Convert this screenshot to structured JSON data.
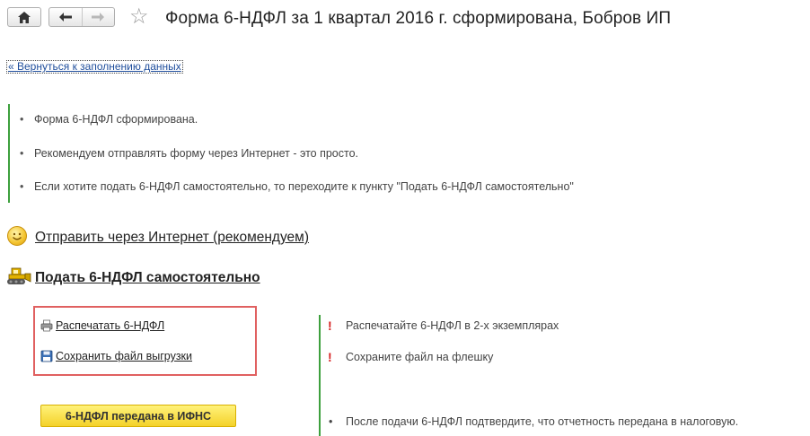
{
  "window": {
    "title": "Форма 6-НДФЛ за 1 квартал 2016 г. сформирована, Бобров ИП"
  },
  "toolbar": {
    "home_icon": "home-icon",
    "back_icon": "arrow-left-icon",
    "forward_icon": "arrow-right-icon",
    "favorite_icon": "star-icon"
  },
  "back_link": "« Вернуться к заполнению данных",
  "info": {
    "items": [
      "Форма 6-НДФЛ сформирована.",
      "Рекомендуем отправлять форму через Интернет - это просто.",
      "Если хотите подать 6-НДФЛ самостоятельно, то переходите к пункту \"Подать 6-НДФЛ самостоятельно\""
    ]
  },
  "options": {
    "internet_label": "Отправить через Интернет (рекомендуем)",
    "internet_icon": "smile-icon",
    "self_label": "Подать 6-НДФЛ самостоятельно",
    "self_icon": "bulldozer-icon"
  },
  "actions": {
    "print_label": "Распечатать 6-НДФЛ",
    "print_icon": "printer-icon",
    "save_label": "Сохранить файл выгрузки",
    "save_icon": "floppy-disk-icon"
  },
  "notes": {
    "mark": "!",
    "bullet": "•",
    "print_note": "Распечатайте 6-НДФЛ в 2-х экземплярах",
    "save_note": "Сохраните файл на флешку",
    "confirm_note": "После подачи 6-НДФЛ подтвердите, что отчетность передана в налоговую."
  },
  "submitted_button": "6-НДФЛ передана в ИФНС",
  "colors": {
    "green_bar": "#3da03d",
    "highlight_border": "#e06060",
    "exclamation": "#d62020",
    "button_yellow": "#f4d22a"
  }
}
